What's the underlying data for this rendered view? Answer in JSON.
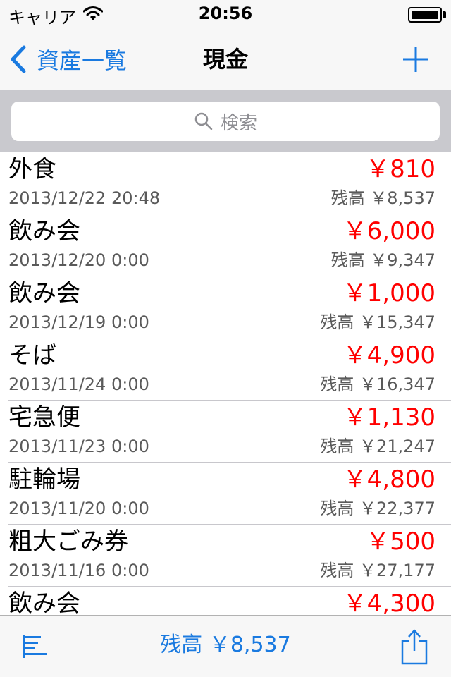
{
  "status_bar": {
    "carrier": "キャリア",
    "time": "20:56"
  },
  "nav": {
    "back_label": "資産一覧",
    "title": "現金"
  },
  "search": {
    "placeholder": "検索"
  },
  "transactions": [
    {
      "title": "外食",
      "amount": "￥810",
      "date": "2013/12/22 20:48",
      "balance": "残高 ￥8,537"
    },
    {
      "title": "飲み会",
      "amount": "￥6,000",
      "date": "2013/12/20 0:00",
      "balance": "残高 ￥9,347"
    },
    {
      "title": "飲み会",
      "amount": "￥1,000",
      "date": "2013/12/19 0:00",
      "balance": "残高 ￥15,347"
    },
    {
      "title": "そば",
      "amount": "￥4,900",
      "date": "2013/11/24 0:00",
      "balance": "残高 ￥16,347"
    },
    {
      "title": "宅急便",
      "amount": "￥1,130",
      "date": "2013/11/23 0:00",
      "balance": "残高 ￥21,247"
    },
    {
      "title": "駐輪場",
      "amount": "￥4,800",
      "date": "2013/11/20 0:00",
      "balance": "残高 ￥22,377"
    },
    {
      "title": "粗大ごみ券",
      "amount": "￥500",
      "date": "2013/11/16 0:00",
      "balance": "残高 ￥27,177"
    },
    {
      "title": "飲み会",
      "amount": "￥4,300",
      "date": "",
      "balance": ""
    }
  ],
  "toolbar": {
    "total_balance": "残高 ￥8,537"
  },
  "colors": {
    "accent": "#1a7ae0",
    "expense": "#ff0000",
    "secondary_text": "#5a5a5a"
  }
}
